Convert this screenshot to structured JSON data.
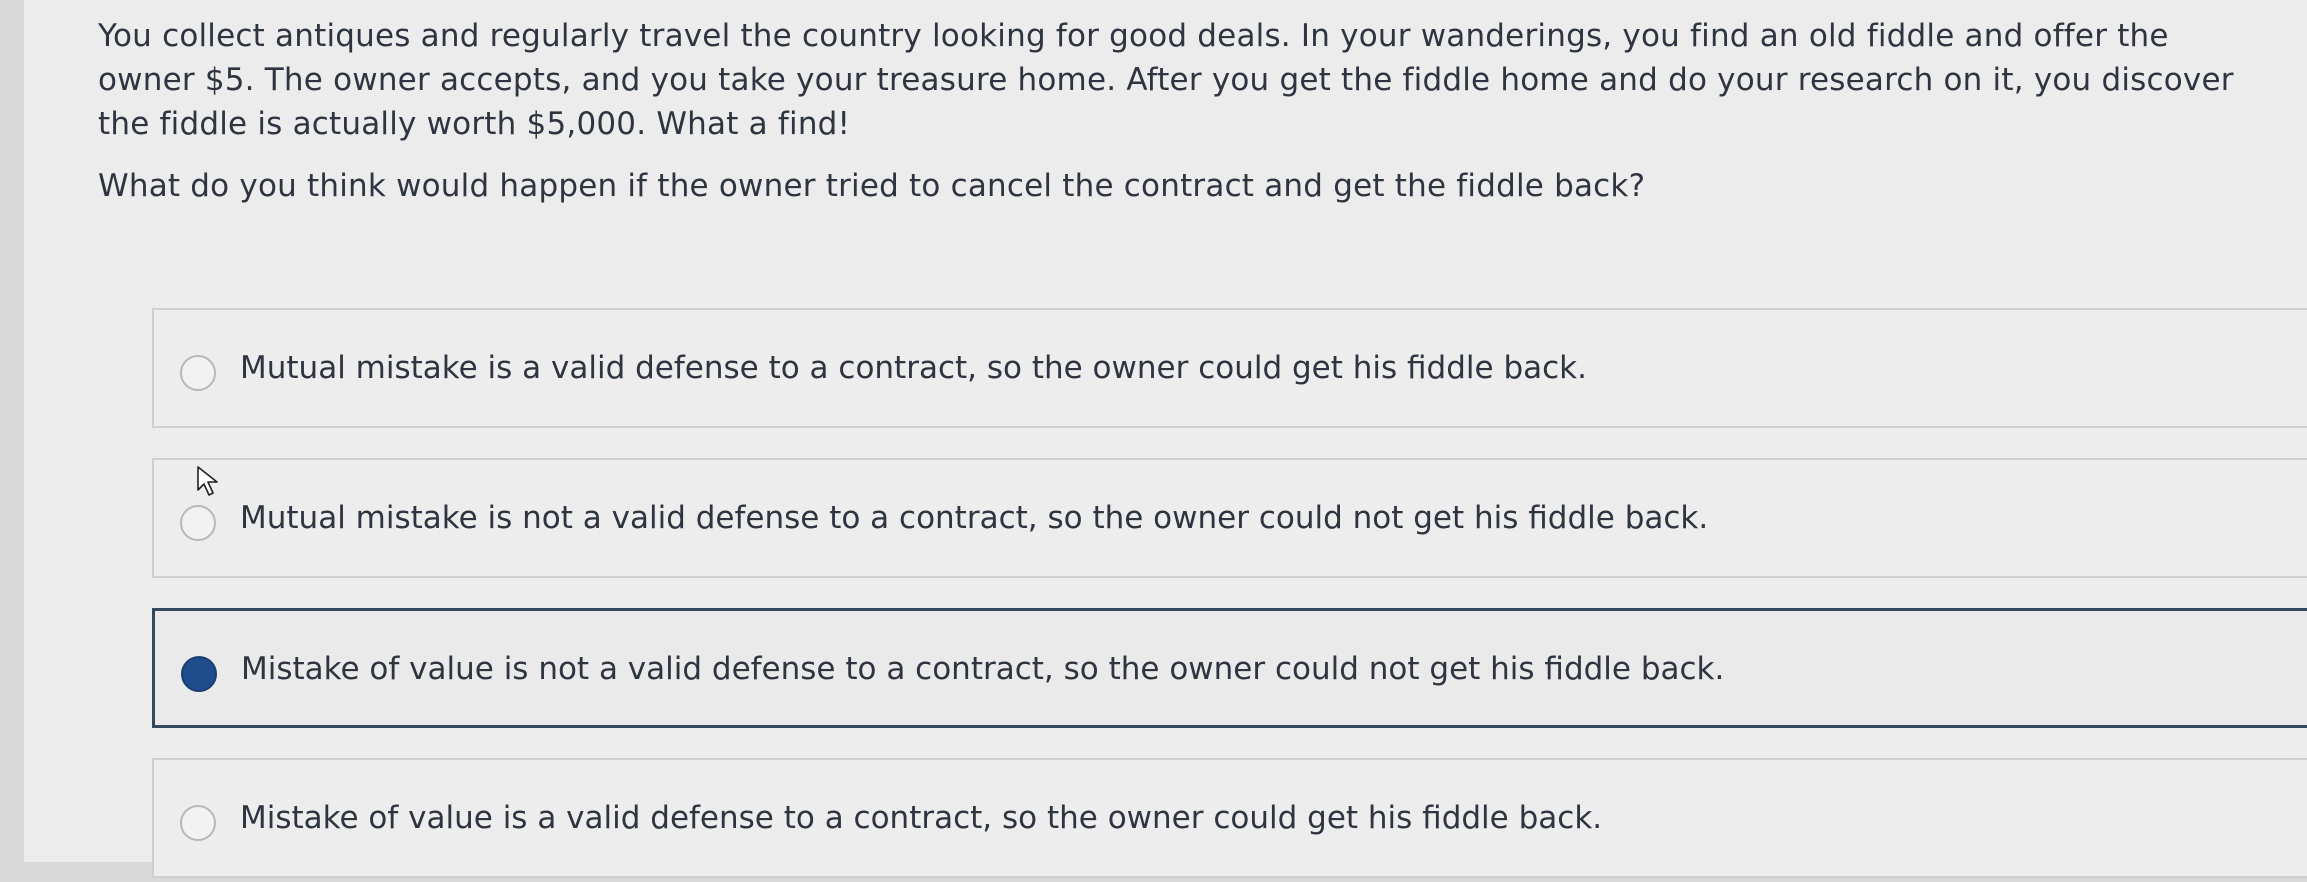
{
  "question": {
    "prompt": "You collect antiques and regularly travel the country looking for good deals. In your wanderings, you find an old fiddle and offer the owner $5. The owner accepts, and you take your treasure home. After you get the fiddle home and do your research on it, you discover the fiddle is actually worth $5,000. What a find!",
    "ask": "What do you think would happen if the owner tried to cancel the contract and get the fiddle back?"
  },
  "answers": [
    {
      "label": "Mutual mistake is a valid defense to a contract, so the owner could get his fiddle back.",
      "selected": false
    },
    {
      "label": "Mutual mistake is not a valid defense to a contract, so the owner could not get his fiddle back.",
      "selected": false
    },
    {
      "label": "Mistake of value is not a valid defense to a contract, so the owner could not get his fiddle back.",
      "selected": true
    },
    {
      "label": "Mistake of value is a valid defense to a contract, so the owner could get his fiddle back.",
      "selected": false
    }
  ],
  "icons": {
    "cursor": "mouse-pointer-icon"
  },
  "colors": {
    "selected_radio": "#1f4c8c",
    "selected_border": "#34495e"
  }
}
